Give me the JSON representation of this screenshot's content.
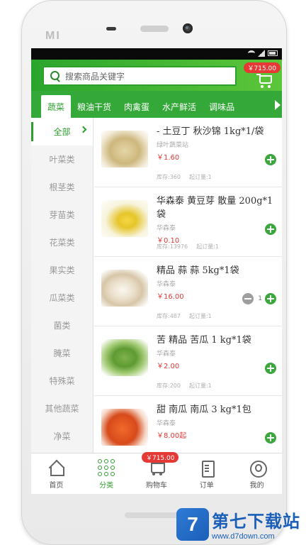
{
  "device": {
    "brand": "MI"
  },
  "search": {
    "placeholder": "搜索商品关键字"
  },
  "cart": {
    "total": "￥715.00"
  },
  "tabs": [
    {
      "label": "蔬菜"
    },
    {
      "label": "粮油干货"
    },
    {
      "label": "肉禽蛋"
    },
    {
      "label": "水产鲜活"
    },
    {
      "label": "调味品"
    }
  ],
  "categories": [
    {
      "label": "全部"
    },
    {
      "label": "叶菜类"
    },
    {
      "label": "根茎类"
    },
    {
      "label": "芽苗类"
    },
    {
      "label": "花菜类"
    },
    {
      "label": "果实类"
    },
    {
      "label": "瓜菜类"
    },
    {
      "label": "菌类"
    },
    {
      "label": "腌菜"
    },
    {
      "label": "特殊菜"
    },
    {
      "label": "其他蔬菜"
    },
    {
      "label": "净菜"
    }
  ],
  "products": [
    {
      "name": "- 土豆丁 秋沙锦 1kg*1/袋",
      "brand": "绿叶蔬菜站",
      "price": "￥1.60",
      "stock": "库存:360",
      "min_order": "起订量:1",
      "image": "potato-image"
    },
    {
      "name": "华森泰 黄豆芽 散量 200g*1袋",
      "brand": "华森泰",
      "price": "￥0.10",
      "stock": "库存:13976",
      "min_order": "起订量:1",
      "image": "bean-sprout-image"
    },
    {
      "name": "精品 蒜 蒜 5kg*1袋",
      "brand": "华森泰",
      "price": "￥16.00",
      "stock": "库存:487",
      "min_order": "起订量:1",
      "image": "garlic-image",
      "qty": "1"
    },
    {
      "name": "苦 精品 苦瓜 1 kg*1袋",
      "brand": "华森泰",
      "price": "￥2.00",
      "stock": "库存:200",
      "min_order": "起订量:1",
      "image": "bitter-melon-image"
    },
    {
      "name": "甜 南瓜 南瓜 3 kg*1包",
      "brand": "华森泰",
      "price": "￥8.00起",
      "stock": "",
      "min_order": "",
      "image": "pumpkin-image"
    }
  ],
  "nav": {
    "home": "首页",
    "category": "分类",
    "cart": "购物车",
    "cart_badge": "￥715.00",
    "orders": "订单",
    "mine": "我的"
  },
  "watermark": {
    "title": "第七下载站",
    "url": "www.d7down.com"
  },
  "colors": {
    "brand_green": "#34a838",
    "price_red": "#e53935"
  }
}
